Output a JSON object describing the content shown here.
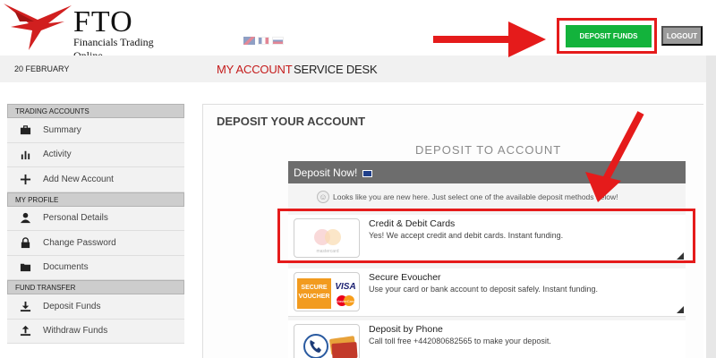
{
  "brand": {
    "name": "FTO",
    "tagline": "Financials Trading Online"
  },
  "header": {
    "deposit_button": "DEPOSIT FUNDS",
    "logout_button": "LOGOUT",
    "languages": [
      "uk-flag",
      "fr-flag",
      "ru-flag"
    ]
  },
  "nav": {
    "date": "20 FEBRUARY",
    "tabs": [
      {
        "label": "MY ACCOUNT",
        "active": true
      },
      {
        "label": "SERVICE DESK",
        "active": false
      }
    ]
  },
  "sidebar": {
    "sections": [
      {
        "title": "TRADING ACCOUNTS",
        "items": [
          {
            "label": "Summary",
            "icon": "briefcase-icon"
          },
          {
            "label": "Activity",
            "icon": "bar-chart-icon"
          },
          {
            "label": "Add New Account",
            "icon": "plus-icon"
          }
        ]
      },
      {
        "title": "MY PROFILE",
        "items": [
          {
            "label": "Personal Details",
            "icon": "user-icon"
          },
          {
            "label": "Change Password",
            "icon": "lock-icon"
          },
          {
            "label": "Documents",
            "icon": "folder-icon"
          }
        ]
      },
      {
        "title": "FUND TRANSFER",
        "items": [
          {
            "label": "Deposit Funds",
            "icon": "download-icon"
          },
          {
            "label": "Withdraw Funds",
            "icon": "upload-icon"
          }
        ]
      }
    ]
  },
  "main": {
    "title": "DEPOSIT YOUR ACCOUNT",
    "subtitle": "DEPOSIT TO ACCOUNT",
    "panel_header": "Deposit Now!",
    "intro": "Looks like you are new here. Just select one of the available deposit methods below!",
    "methods": [
      {
        "name": "Credit & Debit Cards",
        "desc": "Yes! We accept credit and debit cards. Instant funding.",
        "logo": "mastercard-logo",
        "logo_text": "mastercard"
      },
      {
        "name": "Secure Evoucher",
        "desc": "Use your card or bank account to deposit safely. Instant funding.",
        "logo": "secure-voucher-visa-logo",
        "logo_text_1": "SECURE",
        "logo_text_2": "VOUCHER",
        "logo_text_3": "VISA",
        "logo_text_4": "MasterCard"
      },
      {
        "name": "Deposit by Phone",
        "desc": "Call toll free +442080682565 to make your deposit.",
        "logo": "phone-card-logo"
      }
    ]
  },
  "colors": {
    "accent_red": "#c41b1b",
    "highlight_red": "#e51b1b",
    "deposit_green": "#13b33c",
    "logout_gray": "#9b9b9b",
    "panel_header": "#6d6d6d"
  }
}
